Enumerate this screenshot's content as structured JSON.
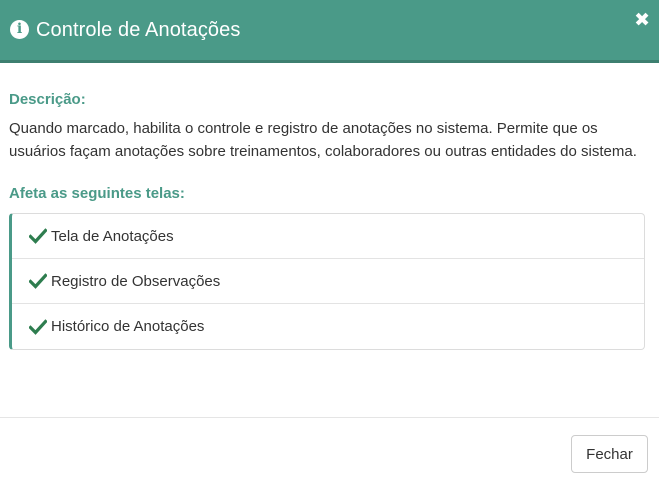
{
  "header": {
    "title": "Controle de Anotações",
    "close_symbol": "✖"
  },
  "body": {
    "description_label": "Descrição:",
    "description_text": "Quando marcado, habilita o controle e registro de anotações no sistema. Permite que os usuários façam anotações sobre treinamentos, colaboradores ou outras entidades do sistema.",
    "screens_label": "Afeta as seguintes telas:",
    "screens": [
      {
        "label": "Tela de Anotações"
      },
      {
        "label": "Registro de Observações"
      },
      {
        "label": "Histórico de Anotações"
      }
    ]
  },
  "footer": {
    "close_label": "Fechar"
  },
  "colors": {
    "accent": "#4a9a88",
    "check": "#2e7d4f"
  },
  "icons": {
    "header": "info-icon",
    "close": "close-icon",
    "item": "check-icon"
  }
}
